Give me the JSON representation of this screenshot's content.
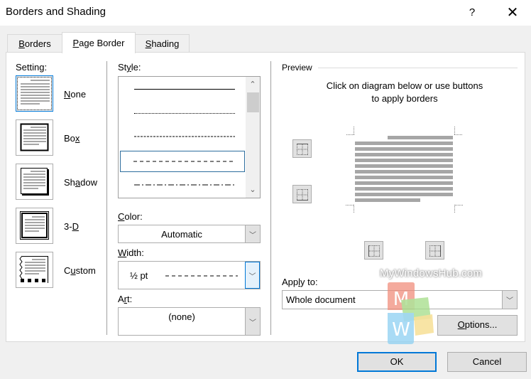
{
  "window": {
    "title": "Borders and Shading",
    "help_label": "?",
    "close_label": "✕"
  },
  "tabs": [
    {
      "label_pre": "",
      "label_u": "B",
      "label_post": "orders",
      "active": false
    },
    {
      "label_pre": "",
      "label_u": "P",
      "label_post": "age Border",
      "active": true
    },
    {
      "label_pre": "",
      "label_u": "S",
      "label_post": "hading",
      "active": false
    }
  ],
  "setting": {
    "heading": "Setting:",
    "items": [
      {
        "pre": "",
        "u": "N",
        "post": "one",
        "icon": "setting-none-icon",
        "selected": true
      },
      {
        "pre": "Bo",
        "u": "x",
        "post": "",
        "icon": "setting-box-icon",
        "selected": false
      },
      {
        "pre": "Sh",
        "u": "a",
        "post": "dow",
        "icon": "setting-shadow-icon",
        "selected": false
      },
      {
        "pre": "3-",
        "u": "D",
        "post": "",
        "icon": "setting-3d-icon",
        "selected": false
      },
      {
        "pre": "C",
        "u": "u",
        "post": "stom",
        "icon": "setting-custom-icon",
        "selected": false
      }
    ]
  },
  "style": {
    "label_pre": "St",
    "label_u": "y",
    "label_post": "le:",
    "items": [
      "solid",
      "dotted",
      "dashed-small",
      "dashed",
      "dash-dot"
    ],
    "selected_index": 3,
    "scroll_up": "⌃",
    "scroll_down": "⌄"
  },
  "color": {
    "label_pre": "",
    "label_u": "C",
    "label_post": "olor:",
    "value": "Automatic"
  },
  "width": {
    "label_pre": "",
    "label_u": "W",
    "label_post": "idth:",
    "value": "½ pt"
  },
  "art": {
    "label_pre": "A",
    "label_u": "r",
    "label_post": "t:",
    "value": "(none)"
  },
  "preview": {
    "legend": "Preview",
    "hint_line1": "Click on diagram below or use buttons",
    "hint_line2": "to apply borders"
  },
  "apply_to": {
    "label_pre": "App",
    "label_u": "l",
    "label_post": "y to:",
    "value": "Whole document"
  },
  "buttons": {
    "options_pre": "",
    "options_u": "O",
    "options_post": "ptions...",
    "ok": "OK",
    "cancel": "Cancel",
    "dropdown_arrow": "﹀"
  },
  "watermark": {
    "text": "MyWindowsHub.com",
    "m": "M",
    "w": "W",
    "colors": {
      "m": "#f08a78",
      "green": "#a5dd8a",
      "w": "#8fd0f2",
      "yellow": "#f6dc8a"
    }
  }
}
